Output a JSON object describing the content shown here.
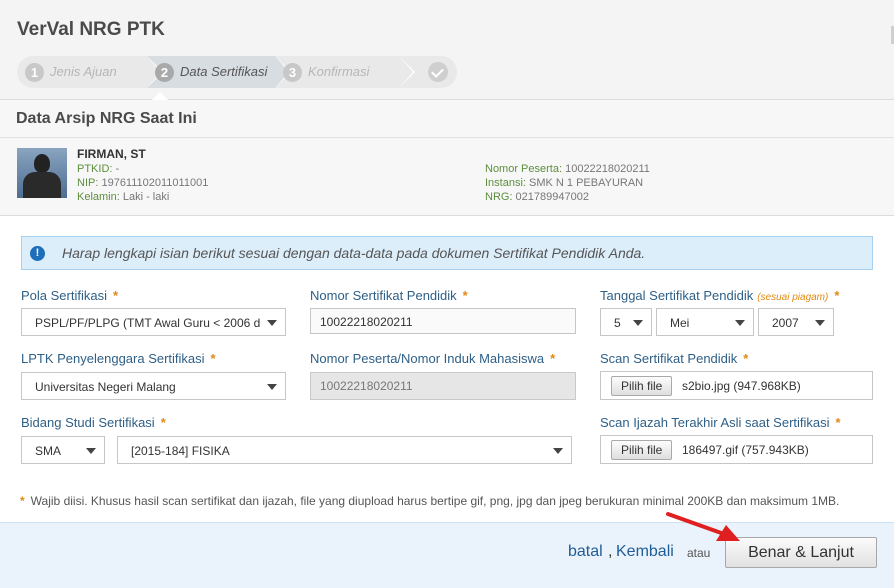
{
  "app": {
    "title": "VerVal NRG PTK"
  },
  "steps": [
    {
      "num": "1",
      "label": "Jenis Ajuan"
    },
    {
      "num": "2",
      "label": "Data Sertifikasi"
    },
    {
      "num": "3",
      "label": "Konfirmasi"
    }
  ],
  "archive": {
    "title": "Data Arsip NRG Saat Ini",
    "name": "FIRMAN, ST",
    "ptkid_label": "PTKID:",
    "ptkid": " -",
    "nip_label": "NIP:",
    "nip": " 197611102011011001",
    "kelamin_label": "Kelamin:",
    "kelamin": " Laki - laki",
    "nomor_peserta_label": "Nomor Peserta:",
    "nomor_peserta": " 10022218020211",
    "instansi_label": "Instansi:",
    "instansi": " SMK N 1 PEBAYURAN",
    "nrg_label": "NRG:",
    "nrg": " 021789947002"
  },
  "alert": {
    "text": "Harap lengkapi isian berikut sesuai dengan data-data pada dokumen Sertifikat Pendidik Anda."
  },
  "form": {
    "required_mark": "*",
    "pola_label": "Pola Sertifikasi",
    "pola_value": "PSPL/PF/PLPG (TMT Awal Guru < 2006 d",
    "nomor_sertifikat_label": "Nomor Sertifikat Pendidik",
    "nomor_sertifikat_value": "10022218020211",
    "tanggal_label": "Tanggal Sertifikat Pendidik",
    "tanggal_hint": "(sesuai piagam)",
    "tanggal_day": "5",
    "tanggal_month": "Mei",
    "tanggal_year": "2007",
    "lptk_label": "LPTK Penyelenggara Sertifikasi",
    "lptk_value": "Universitas Negeri Malang",
    "nomor_peserta_label": "Nomor Peserta/Nomor Induk Mahasiswa",
    "nomor_peserta_value": "10022218020211",
    "scan_sertifikat_label": "Scan Sertifikat Pendidik",
    "scan_sertifikat_button": "Pilih file",
    "scan_sertifikat_file": "s2bio.jpg (947.968KB)",
    "bidang_label": "Bidang Studi Sertifikasi",
    "bidang_level": "SMA",
    "bidang_value": "[2015-184] FISIKA",
    "scan_ijazah_label": "Scan Ijazah Terakhir Asli saat Sertifikasi",
    "scan_ijazah_button": "Pilih file",
    "scan_ijazah_file": "186497.gif (757.943KB)"
  },
  "note": {
    "text": "Wajib diisi. Khusus hasil scan sertifikat dan ijazah, file yang diupload harus bertipe gif, png, jpg dan jpeg berukuran minimal 200KB dan maksimum 1MB."
  },
  "footer": {
    "batal": "batal",
    "comma": ",",
    "kembali": "Kembali",
    "atau": "atau",
    "submit": "Benar & Lanjut"
  },
  "colors": {
    "accent_red": "#e02020",
    "link_blue": "#1f5d96",
    "label_blue": "#2e5f86",
    "required_orange": "#e08a16"
  },
  "icons": [
    "info-icon",
    "check-icon",
    "caret-down-icon",
    "avatar-photo",
    "red-arrow-annotation"
  ]
}
